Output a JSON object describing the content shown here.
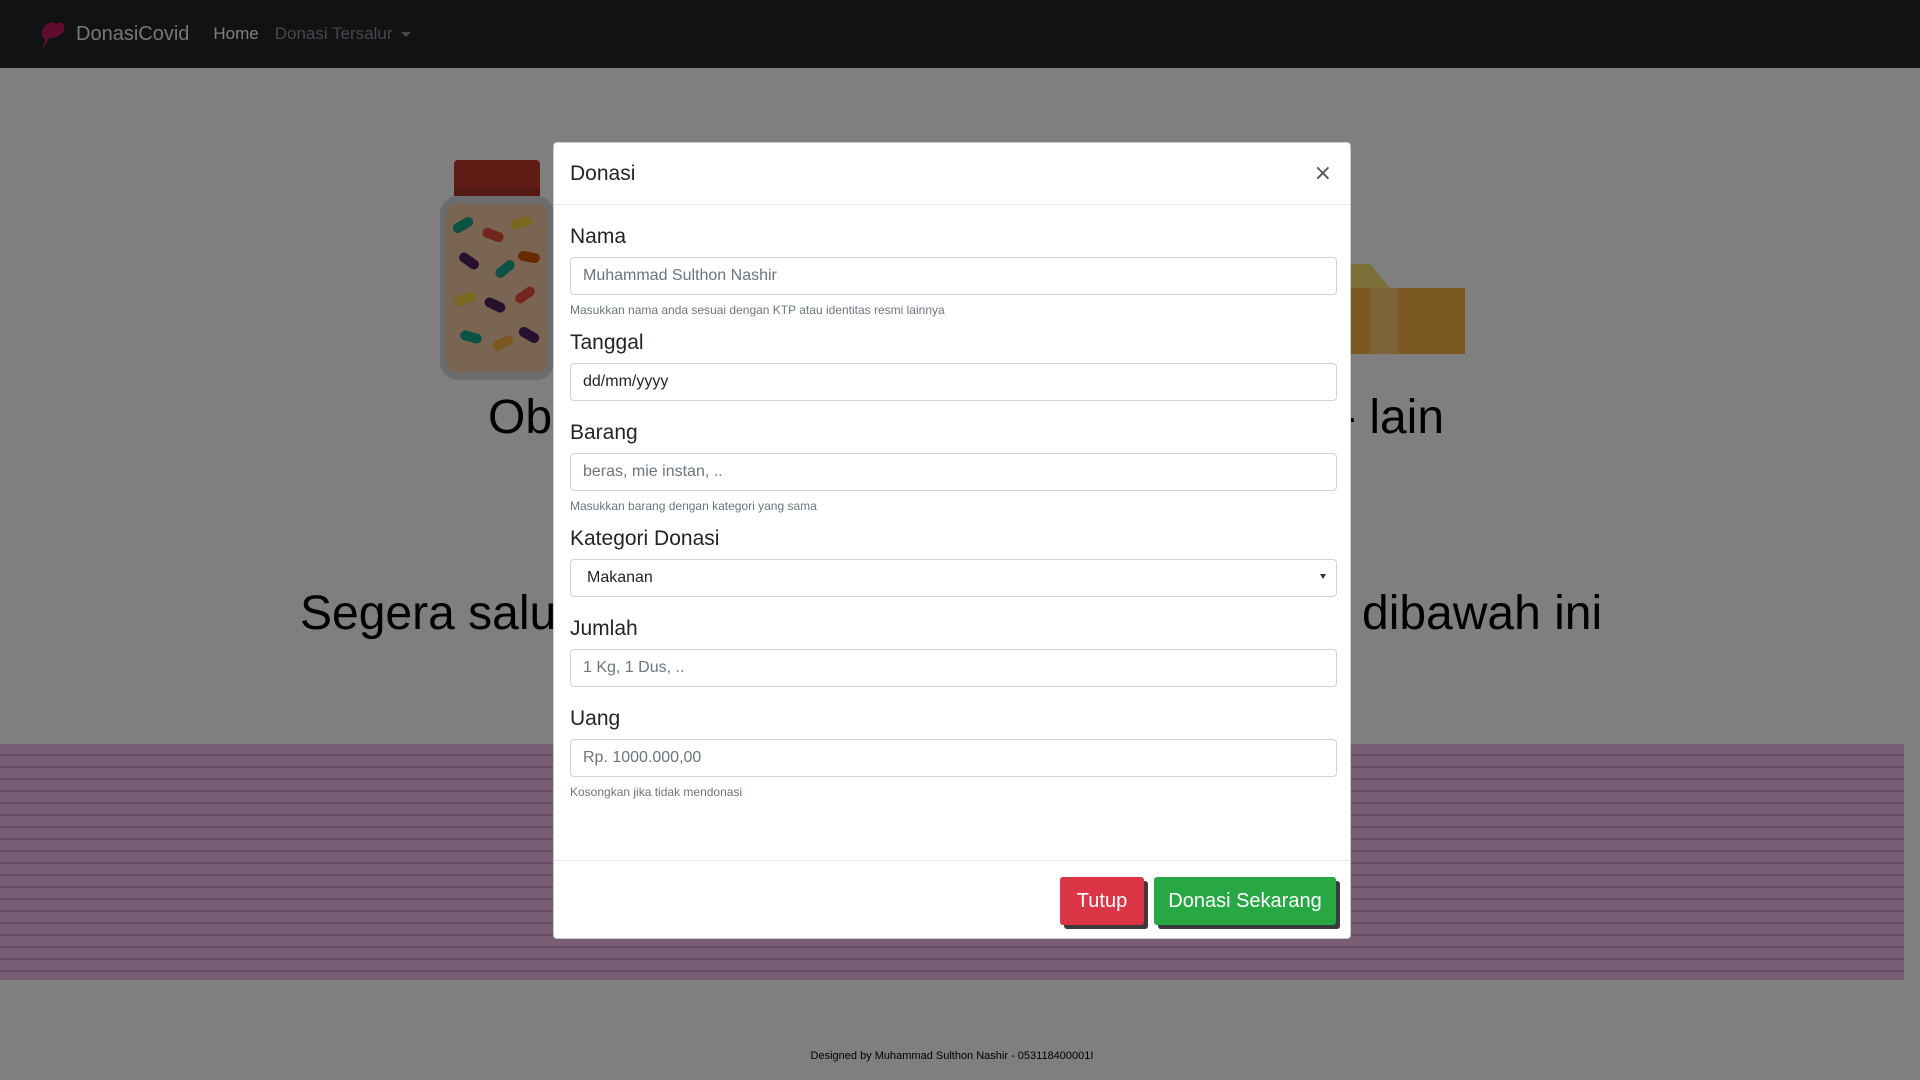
{
  "navbar": {
    "brand": "DonasiCovid",
    "home": "Home",
    "dropdown": "Donasi Tersalur"
  },
  "hero": {
    "line1_left": "Ob",
    "line1_right": "- lain",
    "line2_left": "Segera salur",
    "line2_right": "dibawah ini"
  },
  "footer": "Designed by Muhammad Sulthon Nashir - 053118400001I",
  "modal": {
    "title": "Donasi",
    "close_symbol": "×",
    "fields": {
      "nama": {
        "label": "Nama",
        "placeholder": "Muhammad Sulthon Nashir",
        "help": "Masukkan nama anda sesuai dengan KTP atau identitas resmi lainnya"
      },
      "tanggal": {
        "label": "Tanggal",
        "placeholder": "dd/mm/yyyy"
      },
      "barang": {
        "label": "Barang",
        "placeholder": "beras, mie instan, ..",
        "help": "Masukkan barang dengan kategori yang sama"
      },
      "kategori": {
        "label": "Kategori Donasi",
        "selected": "Makanan"
      },
      "jumlah": {
        "label": "Jumlah",
        "placeholder": "1 Kg, 1 Dus, .."
      },
      "uang": {
        "label": "Uang",
        "placeholder": "Rp. 1000.000,00",
        "help": "Kosongkan jika tidak mendonasi"
      }
    },
    "buttons": {
      "close": "Tutup",
      "submit": "Donasi Sekarang"
    }
  },
  "colors": {
    "navbar": "#212529",
    "danger": "#dc3545",
    "success": "#28a745",
    "pink_band": "#f0bde8",
    "backdrop_opacity": 0.5
  }
}
